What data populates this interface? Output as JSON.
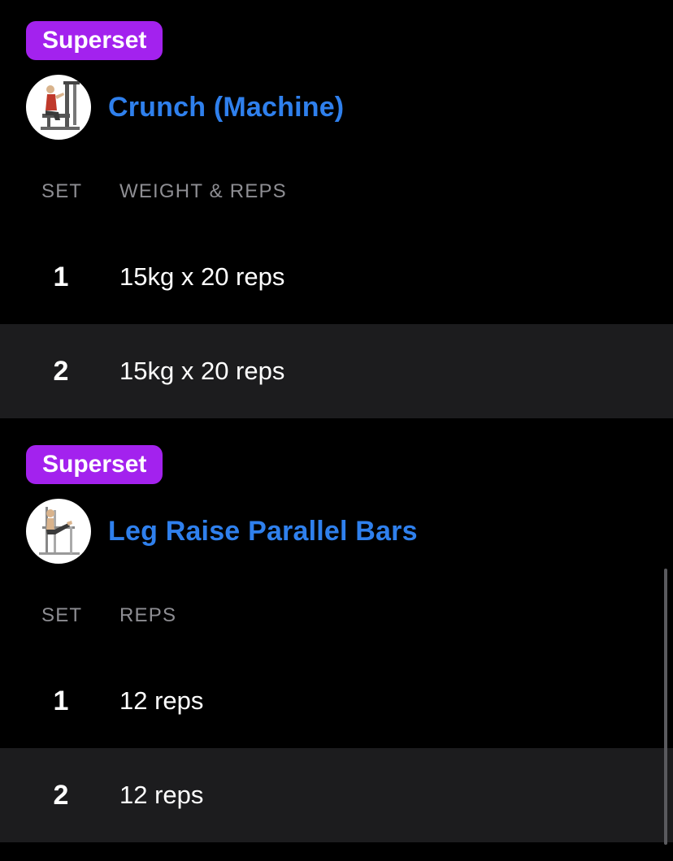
{
  "colors": {
    "background": "#000000",
    "alt_row": "#1c1c1e",
    "badge": "#a322ee",
    "exercise_link": "#2f80ed",
    "header_text": "#8e8e93",
    "text": "#ffffff"
  },
  "exercises": [
    {
      "badge": "Superset",
      "name": "Crunch (Machine)",
      "thumbnail_icon": "crunch-machine-illustration",
      "columns": {
        "set": "SET",
        "metric": "WEIGHT & REPS"
      },
      "sets": [
        {
          "set": "1",
          "value": "15kg x 20 reps"
        },
        {
          "set": "2",
          "value": "15kg x 20 reps"
        }
      ]
    },
    {
      "badge": "Superset",
      "name": "Leg Raise Parallel Bars",
      "thumbnail_icon": "leg-raise-parallel-bars-illustration",
      "columns": {
        "set": "SET",
        "metric": "REPS"
      },
      "sets": [
        {
          "set": "1",
          "value": "12 reps"
        },
        {
          "set": "2",
          "value": "12 reps"
        }
      ]
    }
  ]
}
